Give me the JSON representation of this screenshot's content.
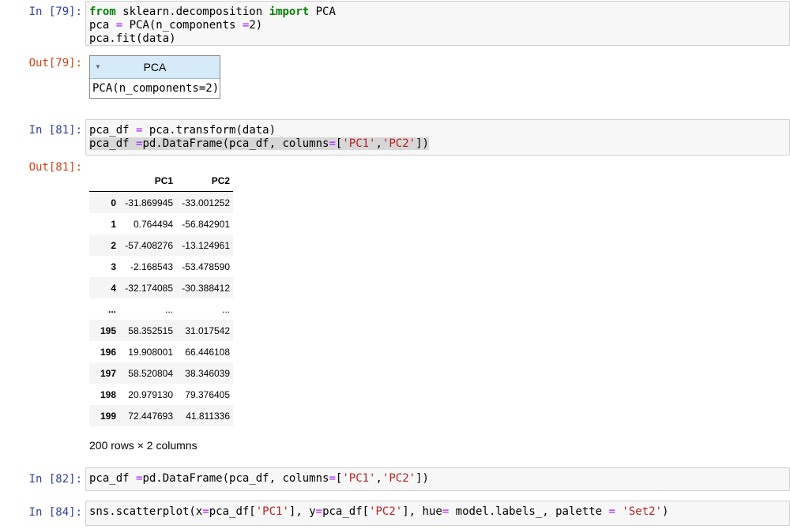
{
  "cells": [
    {
      "in_prompt": "In [79]:",
      "out_prompt": "Out[79]:",
      "estimator": {
        "title": "PCA",
        "repr": "PCA(n_components=2)"
      }
    },
    {
      "in_prompt": "In [81]:",
      "out_prompt": "Out[81]:",
      "dataframe": {
        "columns": [
          "",
          "PC1",
          "PC2"
        ],
        "rows": [
          [
            "0",
            "-31.869945",
            "-33.001252"
          ],
          [
            "1",
            "0.764494",
            "-56.842901"
          ],
          [
            "2",
            "-57.408276",
            "-13.124961"
          ],
          [
            "3",
            "-2.168543",
            "-53.478590"
          ],
          [
            "4",
            "-32.174085",
            "-30.388412"
          ],
          [
            "...",
            "...",
            "..."
          ],
          [
            "195",
            "58.352515",
            "31.017542"
          ],
          [
            "196",
            "19.908001",
            "66.446108"
          ],
          [
            "197",
            "58.520804",
            "38.346039"
          ],
          [
            "198",
            "20.979130",
            "79.376405"
          ],
          [
            "199",
            "72.447693",
            "41.811336"
          ]
        ],
        "shape": "200 rows × 2 columns"
      }
    },
    {
      "in_prompt": "In [82]:"
    },
    {
      "in_prompt": "In [84]:"
    }
  ]
}
